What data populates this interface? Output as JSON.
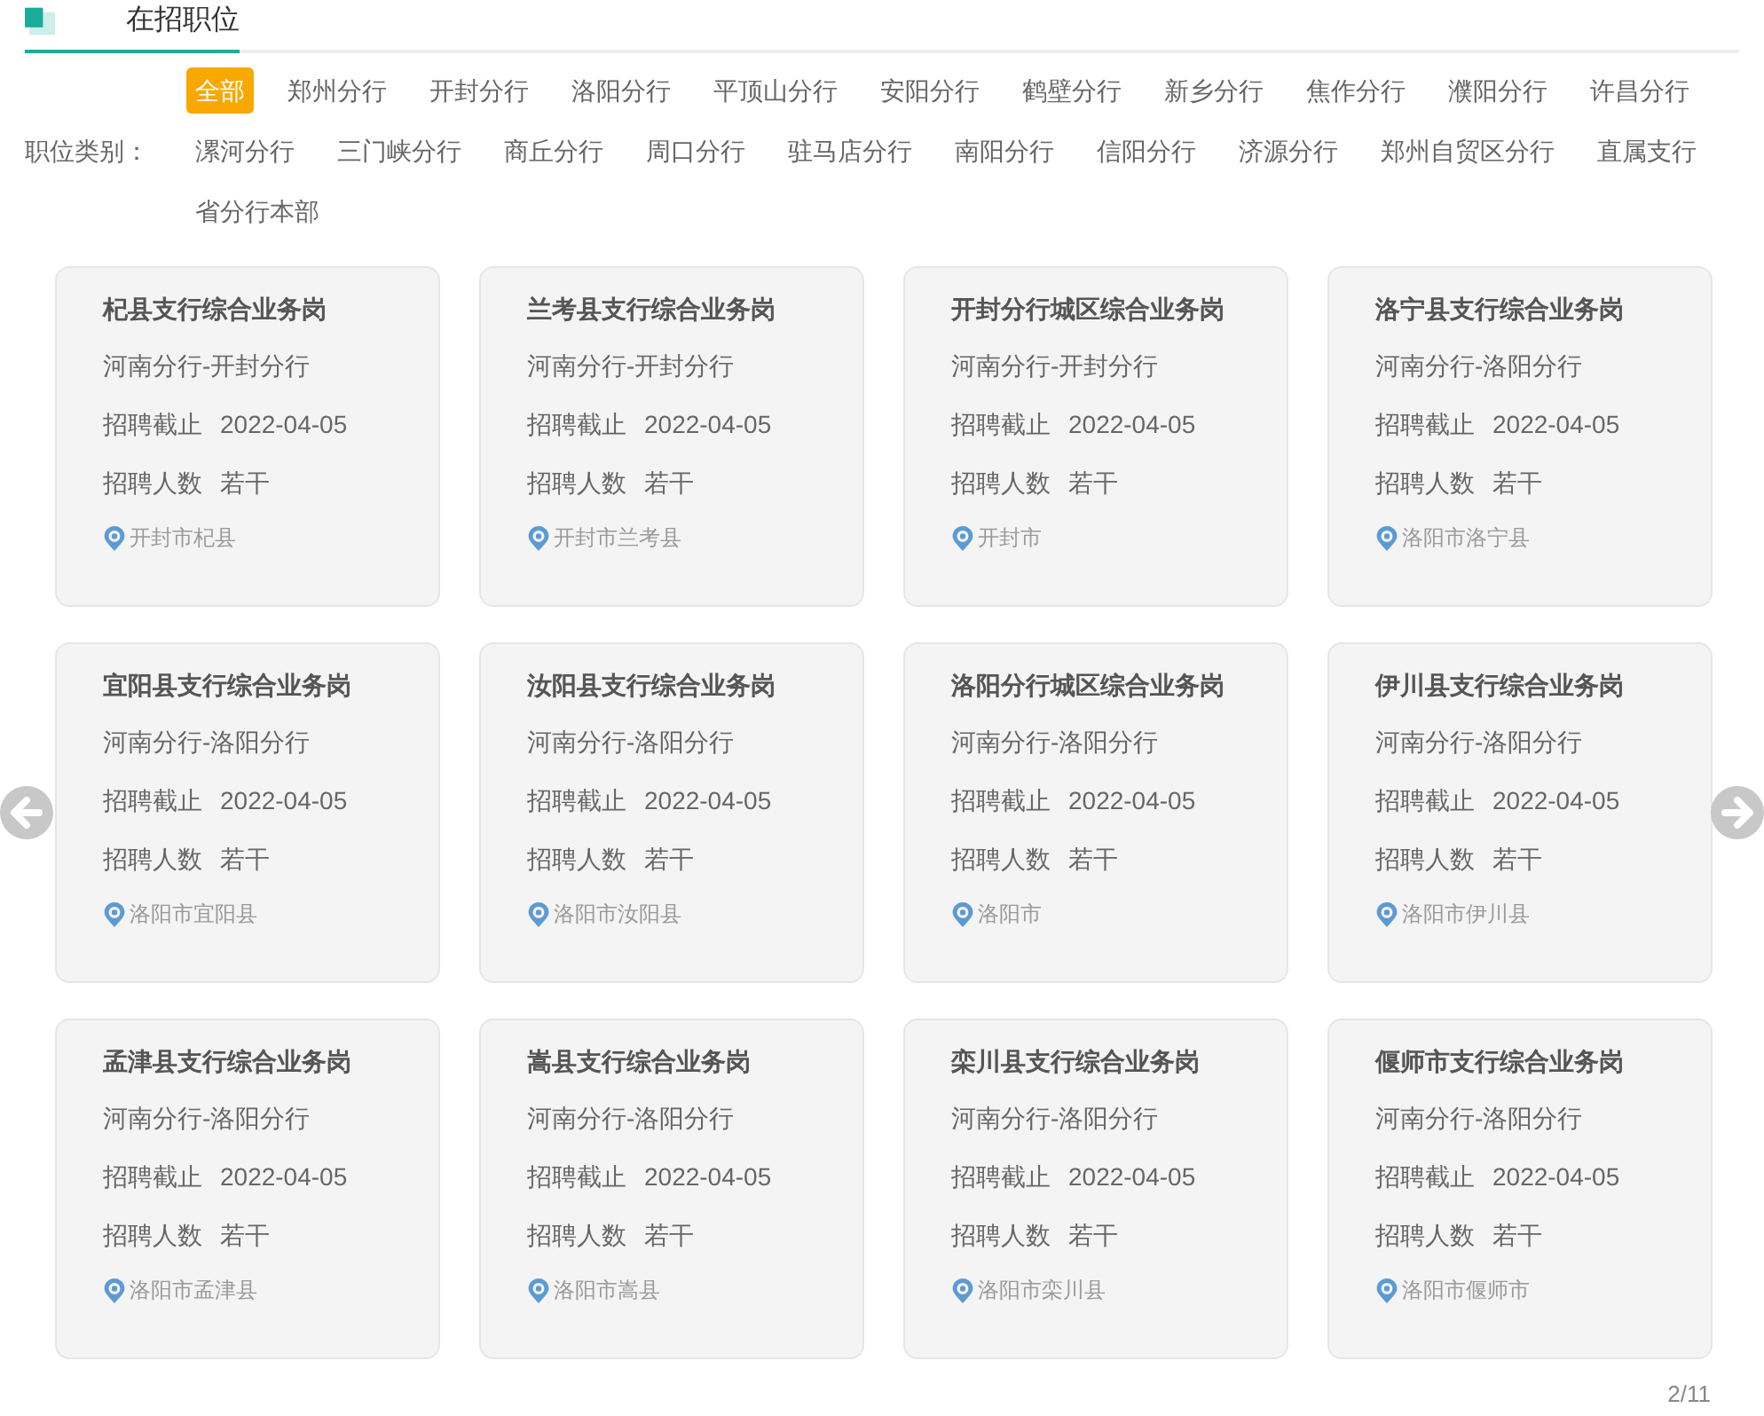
{
  "section": {
    "title": "在招职位"
  },
  "filter": {
    "label": "职位类别：",
    "options": [
      {
        "label": "全部",
        "selected": true
      },
      {
        "label": "郑州分行",
        "selected": false
      },
      {
        "label": "开封分行",
        "selected": false
      },
      {
        "label": "洛阳分行",
        "selected": false
      },
      {
        "label": "平顶山分行",
        "selected": false
      },
      {
        "label": "安阳分行",
        "selected": false
      },
      {
        "label": "鹤壁分行",
        "selected": false
      },
      {
        "label": "新乡分行",
        "selected": false
      },
      {
        "label": "焦作分行",
        "selected": false
      },
      {
        "label": "濮阳分行",
        "selected": false
      },
      {
        "label": "许昌分行",
        "selected": false
      },
      {
        "label": "漯河分行",
        "selected": false
      },
      {
        "label": "三门峡分行",
        "selected": false
      },
      {
        "label": "商丘分行",
        "selected": false
      },
      {
        "label": "周口分行",
        "selected": false
      },
      {
        "label": "驻马店分行",
        "selected": false
      },
      {
        "label": "南阳分行",
        "selected": false
      },
      {
        "label": "信阳分行",
        "selected": false
      },
      {
        "label": "济源分行",
        "selected": false
      },
      {
        "label": "郑州自贸区分行",
        "selected": false
      },
      {
        "label": "直属支行",
        "selected": false
      },
      {
        "label": "省分行本部",
        "selected": false
      }
    ]
  },
  "jobs": [
    {
      "title": "杞县支行综合业务岗",
      "org": "河南分行-开封分行",
      "deadline_label": "招聘截止",
      "deadline": "2022-04-05",
      "count_label": "招聘人数",
      "count": "若干",
      "location": "开封市杞县"
    },
    {
      "title": "兰考县支行综合业务岗",
      "org": "河南分行-开封分行",
      "deadline_label": "招聘截止",
      "deadline": "2022-04-05",
      "count_label": "招聘人数",
      "count": "若干",
      "location": "开封市兰考县"
    },
    {
      "title": "开封分行城区综合业务岗",
      "org": "河南分行-开封分行",
      "deadline_label": "招聘截止",
      "deadline": "2022-04-05",
      "count_label": "招聘人数",
      "count": "若干",
      "location": "开封市"
    },
    {
      "title": "洛宁县支行综合业务岗",
      "org": "河南分行-洛阳分行",
      "deadline_label": "招聘截止",
      "deadline": "2022-04-05",
      "count_label": "招聘人数",
      "count": "若干",
      "location": "洛阳市洛宁县"
    },
    {
      "title": "宜阳县支行综合业务岗",
      "org": "河南分行-洛阳分行",
      "deadline_label": "招聘截止",
      "deadline": "2022-04-05",
      "count_label": "招聘人数",
      "count": "若干",
      "location": "洛阳市宜阳县"
    },
    {
      "title": "汝阳县支行综合业务岗",
      "org": "河南分行-洛阳分行",
      "deadline_label": "招聘截止",
      "deadline": "2022-04-05",
      "count_label": "招聘人数",
      "count": "若干",
      "location": "洛阳市汝阳县"
    },
    {
      "title": "洛阳分行城区综合业务岗",
      "org": "河南分行-洛阳分行",
      "deadline_label": "招聘截止",
      "deadline": "2022-04-05",
      "count_label": "招聘人数",
      "count": "若干",
      "location": "洛阳市"
    },
    {
      "title": "伊川县支行综合业务岗",
      "org": "河南分行-洛阳分行",
      "deadline_label": "招聘截止",
      "deadline": "2022-04-05",
      "count_label": "招聘人数",
      "count": "若干",
      "location": "洛阳市伊川县"
    },
    {
      "title": "孟津县支行综合业务岗",
      "org": "河南分行-洛阳分行",
      "deadline_label": "招聘截止",
      "deadline": "2022-04-05",
      "count_label": "招聘人数",
      "count": "若干",
      "location": "洛阳市孟津县"
    },
    {
      "title": "嵩县支行综合业务岗",
      "org": "河南分行-洛阳分行",
      "deadline_label": "招聘截止",
      "deadline": "2022-04-05",
      "count_label": "招聘人数",
      "count": "若干",
      "location": "洛阳市嵩县"
    },
    {
      "title": "栾川县支行综合业务岗",
      "org": "河南分行-洛阳分行",
      "deadline_label": "招聘截止",
      "deadline": "2022-04-05",
      "count_label": "招聘人数",
      "count": "若干",
      "location": "洛阳市栾川县"
    },
    {
      "title": "偃师市支行综合业务岗",
      "org": "河南分行-洛阳分行",
      "deadline_label": "招聘截止",
      "deadline": "2022-04-05",
      "count_label": "招聘人数",
      "count": "若干",
      "location": "洛阳市偃师市"
    }
  ],
  "pager": {
    "text": "2/11"
  }
}
